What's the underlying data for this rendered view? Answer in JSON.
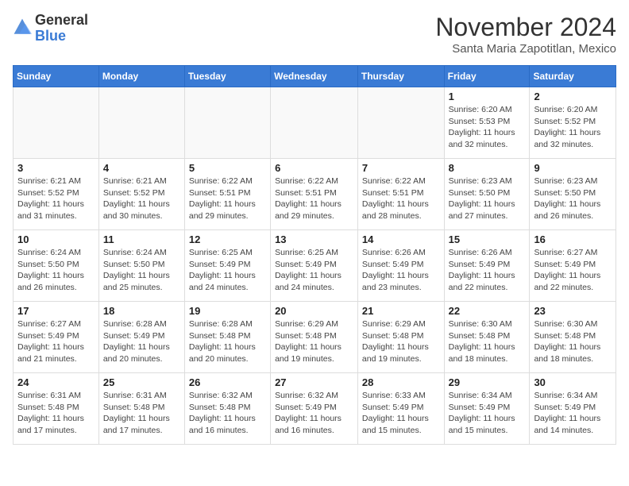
{
  "header": {
    "logo_general": "General",
    "logo_blue": "Blue",
    "month_title": "November 2024",
    "subtitle": "Santa Maria Zapotitlan, Mexico"
  },
  "calendar": {
    "days_of_week": [
      "Sunday",
      "Monday",
      "Tuesday",
      "Wednesday",
      "Thursday",
      "Friday",
      "Saturday"
    ],
    "weeks": [
      [
        {
          "day": "",
          "info": ""
        },
        {
          "day": "",
          "info": ""
        },
        {
          "day": "",
          "info": ""
        },
        {
          "day": "",
          "info": ""
        },
        {
          "day": "",
          "info": ""
        },
        {
          "day": "1",
          "info": "Sunrise: 6:20 AM\nSunset: 5:53 PM\nDaylight: 11 hours\nand 32 minutes."
        },
        {
          "day": "2",
          "info": "Sunrise: 6:20 AM\nSunset: 5:52 PM\nDaylight: 11 hours\nand 32 minutes."
        }
      ],
      [
        {
          "day": "3",
          "info": "Sunrise: 6:21 AM\nSunset: 5:52 PM\nDaylight: 11 hours\nand 31 minutes."
        },
        {
          "day": "4",
          "info": "Sunrise: 6:21 AM\nSunset: 5:52 PM\nDaylight: 11 hours\nand 30 minutes."
        },
        {
          "day": "5",
          "info": "Sunrise: 6:22 AM\nSunset: 5:51 PM\nDaylight: 11 hours\nand 29 minutes."
        },
        {
          "day": "6",
          "info": "Sunrise: 6:22 AM\nSunset: 5:51 PM\nDaylight: 11 hours\nand 29 minutes."
        },
        {
          "day": "7",
          "info": "Sunrise: 6:22 AM\nSunset: 5:51 PM\nDaylight: 11 hours\nand 28 minutes."
        },
        {
          "day": "8",
          "info": "Sunrise: 6:23 AM\nSunset: 5:50 PM\nDaylight: 11 hours\nand 27 minutes."
        },
        {
          "day": "9",
          "info": "Sunrise: 6:23 AM\nSunset: 5:50 PM\nDaylight: 11 hours\nand 26 minutes."
        }
      ],
      [
        {
          "day": "10",
          "info": "Sunrise: 6:24 AM\nSunset: 5:50 PM\nDaylight: 11 hours\nand 26 minutes."
        },
        {
          "day": "11",
          "info": "Sunrise: 6:24 AM\nSunset: 5:50 PM\nDaylight: 11 hours\nand 25 minutes."
        },
        {
          "day": "12",
          "info": "Sunrise: 6:25 AM\nSunset: 5:49 PM\nDaylight: 11 hours\nand 24 minutes."
        },
        {
          "day": "13",
          "info": "Sunrise: 6:25 AM\nSunset: 5:49 PM\nDaylight: 11 hours\nand 24 minutes."
        },
        {
          "day": "14",
          "info": "Sunrise: 6:26 AM\nSunset: 5:49 PM\nDaylight: 11 hours\nand 23 minutes."
        },
        {
          "day": "15",
          "info": "Sunrise: 6:26 AM\nSunset: 5:49 PM\nDaylight: 11 hours\nand 22 minutes."
        },
        {
          "day": "16",
          "info": "Sunrise: 6:27 AM\nSunset: 5:49 PM\nDaylight: 11 hours\nand 22 minutes."
        }
      ],
      [
        {
          "day": "17",
          "info": "Sunrise: 6:27 AM\nSunset: 5:49 PM\nDaylight: 11 hours\nand 21 minutes."
        },
        {
          "day": "18",
          "info": "Sunrise: 6:28 AM\nSunset: 5:49 PM\nDaylight: 11 hours\nand 20 minutes."
        },
        {
          "day": "19",
          "info": "Sunrise: 6:28 AM\nSunset: 5:48 PM\nDaylight: 11 hours\nand 20 minutes."
        },
        {
          "day": "20",
          "info": "Sunrise: 6:29 AM\nSunset: 5:48 PM\nDaylight: 11 hours\nand 19 minutes."
        },
        {
          "day": "21",
          "info": "Sunrise: 6:29 AM\nSunset: 5:48 PM\nDaylight: 11 hours\nand 19 minutes."
        },
        {
          "day": "22",
          "info": "Sunrise: 6:30 AM\nSunset: 5:48 PM\nDaylight: 11 hours\nand 18 minutes."
        },
        {
          "day": "23",
          "info": "Sunrise: 6:30 AM\nSunset: 5:48 PM\nDaylight: 11 hours\nand 18 minutes."
        }
      ],
      [
        {
          "day": "24",
          "info": "Sunrise: 6:31 AM\nSunset: 5:48 PM\nDaylight: 11 hours\nand 17 minutes."
        },
        {
          "day": "25",
          "info": "Sunrise: 6:31 AM\nSunset: 5:48 PM\nDaylight: 11 hours\nand 17 minutes."
        },
        {
          "day": "26",
          "info": "Sunrise: 6:32 AM\nSunset: 5:48 PM\nDaylight: 11 hours\nand 16 minutes."
        },
        {
          "day": "27",
          "info": "Sunrise: 6:32 AM\nSunset: 5:49 PM\nDaylight: 11 hours\nand 16 minutes."
        },
        {
          "day": "28",
          "info": "Sunrise: 6:33 AM\nSunset: 5:49 PM\nDaylight: 11 hours\nand 15 minutes."
        },
        {
          "day": "29",
          "info": "Sunrise: 6:34 AM\nSunset: 5:49 PM\nDaylight: 11 hours\nand 15 minutes."
        },
        {
          "day": "30",
          "info": "Sunrise: 6:34 AM\nSunset: 5:49 PM\nDaylight: 11 hours\nand 14 minutes."
        }
      ]
    ]
  }
}
